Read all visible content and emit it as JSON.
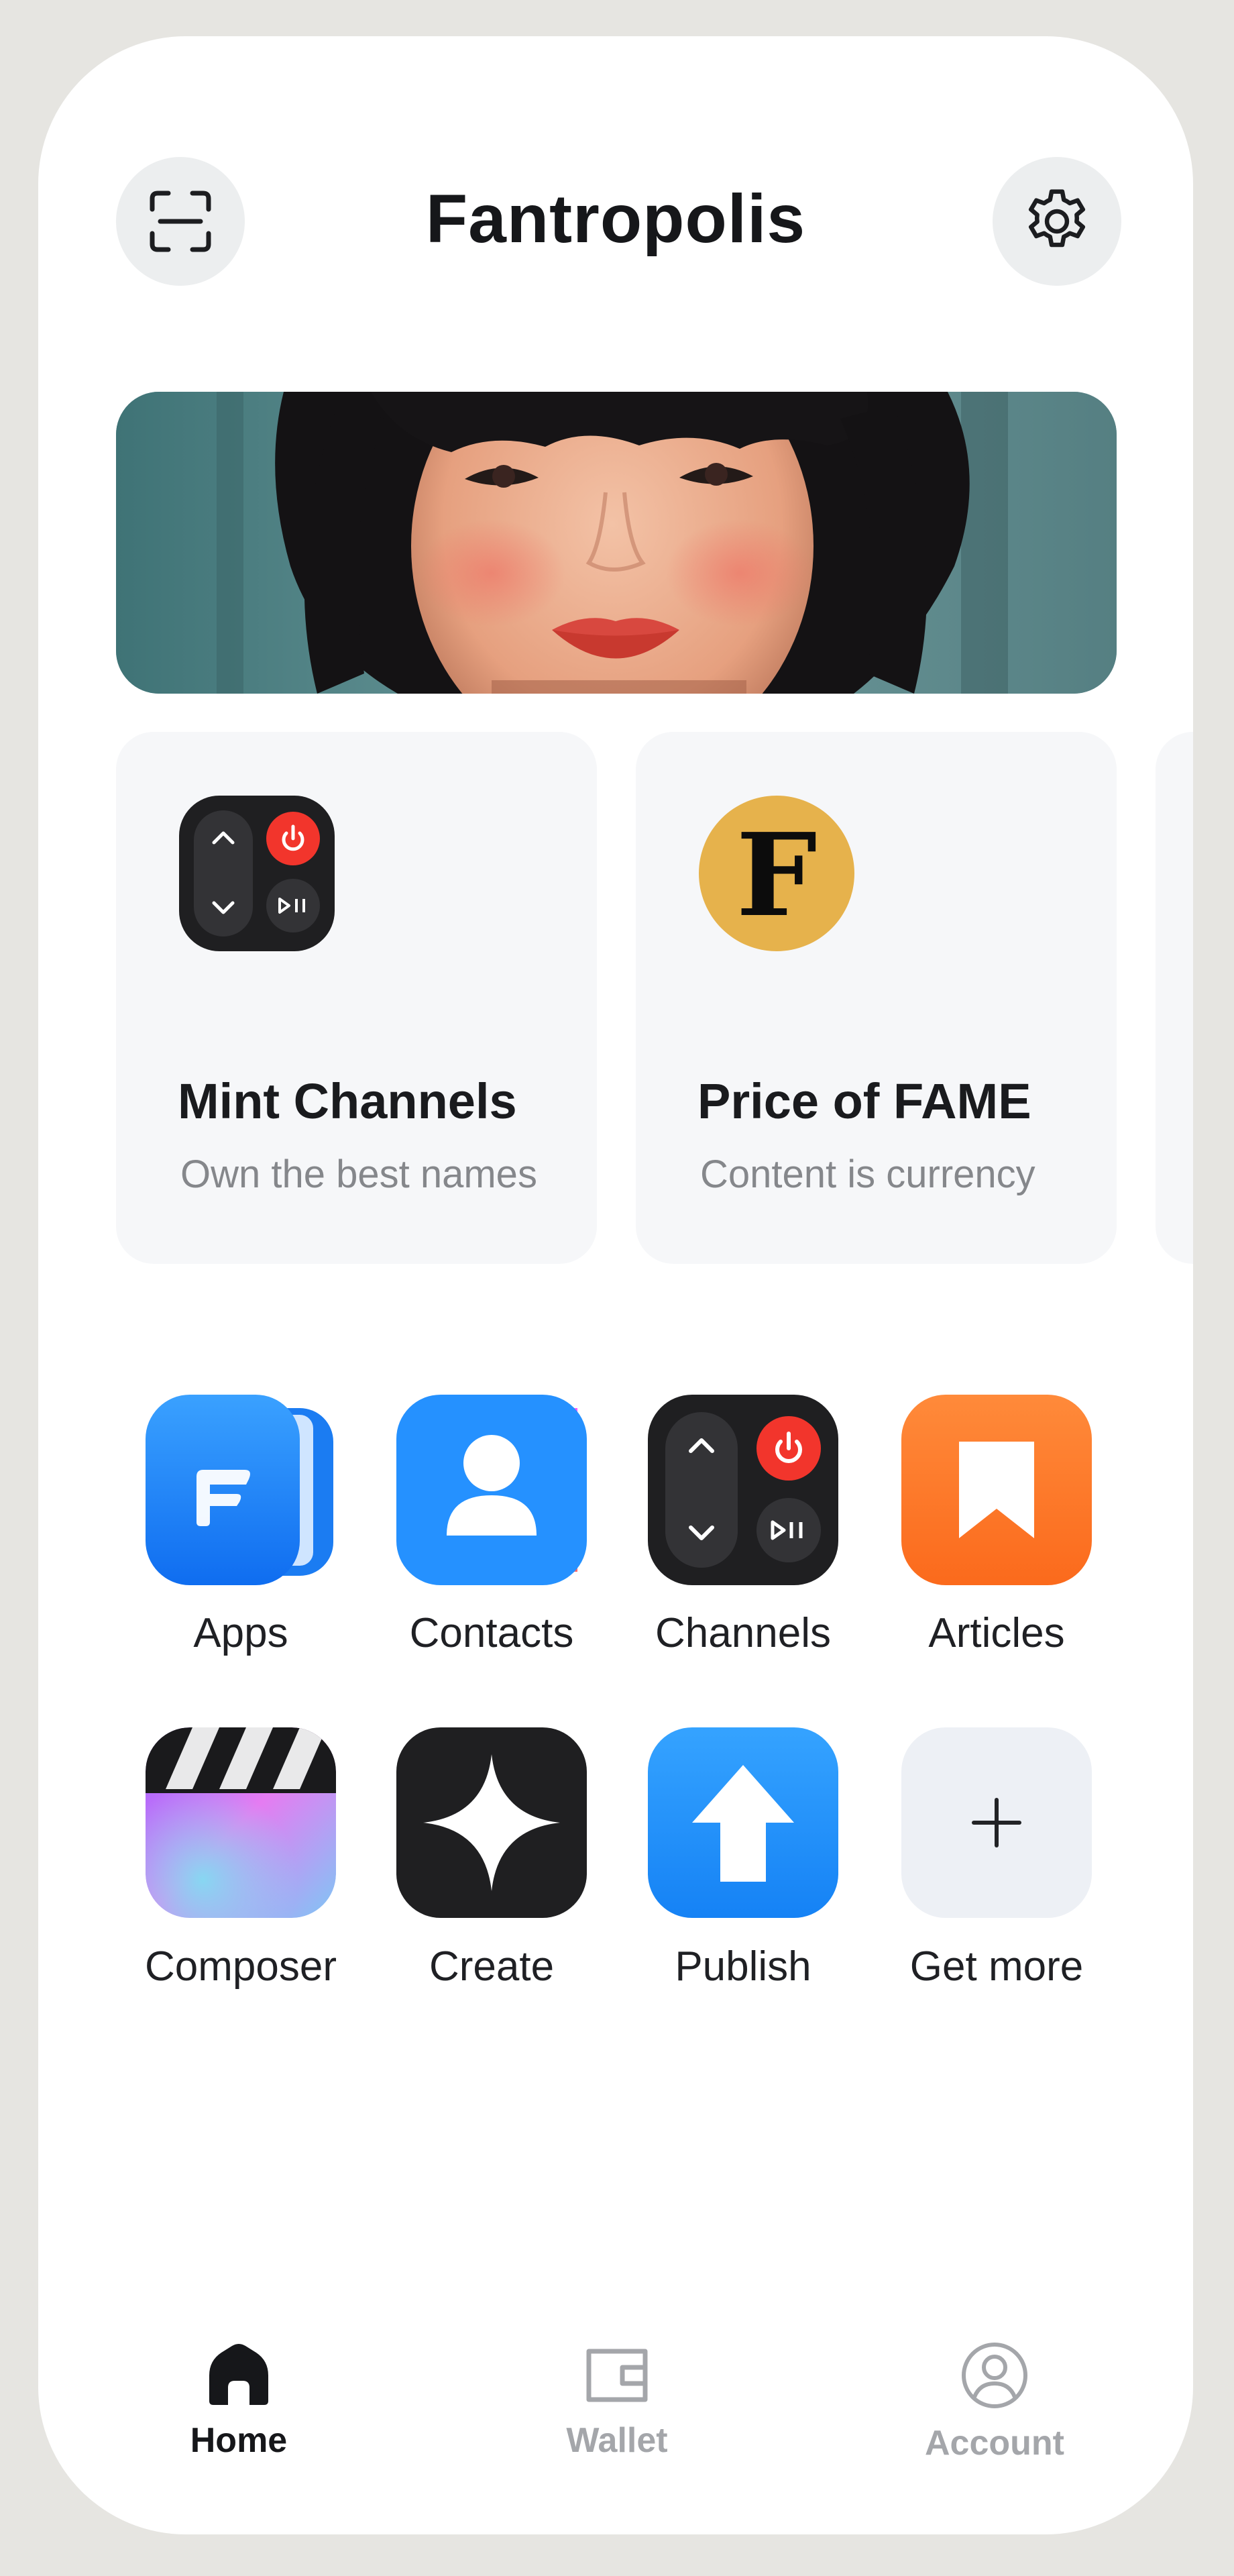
{
  "header": {
    "title": "Fantropolis",
    "scan_icon": "scan-icon",
    "settings_icon": "gear-icon"
  },
  "banner": {
    "image": "portrait-photo"
  },
  "cards": [
    {
      "title": "Mint Channels",
      "subtitle": "Own the best names",
      "icon": "remote-control-icon"
    },
    {
      "title": "Price of FAME",
      "subtitle": "Content is currency",
      "icon": "fame-coin-icon",
      "icon_letter": "F"
    }
  ],
  "apps": [
    {
      "label": "Apps",
      "icon": "apps-book-icon"
    },
    {
      "label": "Contacts",
      "icon": "contacts-icon"
    },
    {
      "label": "Channels",
      "icon": "remote-control-icon"
    },
    {
      "label": "Articles",
      "icon": "bookmark-icon"
    },
    {
      "label": "Composer",
      "icon": "clapperboard-icon"
    },
    {
      "label": "Create",
      "icon": "sparkle-icon"
    },
    {
      "label": "Publish",
      "icon": "upload-arrow-icon"
    },
    {
      "label": "Get more",
      "icon": "plus-icon"
    }
  ],
  "tabbar": [
    {
      "label": "Home",
      "icon": "home-icon",
      "active": true
    },
    {
      "label": "Wallet",
      "icon": "wallet-icon",
      "active": false
    },
    {
      "label": "Account",
      "icon": "account-icon",
      "active": false
    }
  ],
  "colors": {
    "active_tab": "#16171a",
    "inactive_tab": "#a4a6aa",
    "fame_coin": "#e6b24c",
    "articles_orange": "#fe7a2a",
    "blue": "#1e8bff",
    "power_red": "#f2352c"
  }
}
